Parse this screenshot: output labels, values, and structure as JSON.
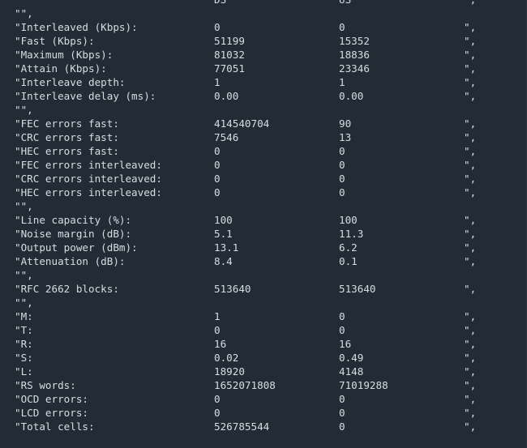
{
  "lines": [
    {
      "label": "",
      "ds": "DS",
      "us": "US",
      "end": "\","
    },
    {
      "label": "\"\",",
      "ds": "",
      "us": "",
      "end": ""
    },
    {
      "label": "\"Interleaved (Kbps):",
      "ds": "0",
      "us": "0",
      "end": "\","
    },
    {
      "label": "\"Fast (Kbps):",
      "ds": "51199",
      "us": "15352",
      "end": "\","
    },
    {
      "label": "\"Maximum (Kbps):",
      "ds": "81032",
      "us": "18836",
      "end": "\","
    },
    {
      "label": "\"Attain (Kbps):",
      "ds": "77051",
      "us": "23346",
      "end": "\","
    },
    {
      "label": "\"Interleave depth:",
      "ds": "1",
      "us": "1",
      "end": "\","
    },
    {
      "label": "\"Interleave delay (ms):",
      "ds": "0.00",
      "us": "0.00",
      "end": "\","
    },
    {
      "label": "\"\",",
      "ds": "",
      "us": "",
      "end": ""
    },
    {
      "label": "\"FEC errors fast:",
      "ds": "414540704",
      "us": "90",
      "end": "\","
    },
    {
      "label": "\"CRC errors fast:",
      "ds": "7546",
      "us": "13",
      "end": "\","
    },
    {
      "label": "\"HEC errors fast:",
      "ds": "0",
      "us": "0",
      "end": "\","
    },
    {
      "label": "\"FEC errors interleaved:",
      "ds": "0",
      "us": "0",
      "end": "\","
    },
    {
      "label": "\"CRC errors interleaved:",
      "ds": "0",
      "us": "0",
      "end": "\","
    },
    {
      "label": "\"HEC errors interleaved:",
      "ds": "0",
      "us": "0",
      "end": "\","
    },
    {
      "label": "\"\",",
      "ds": "",
      "us": "",
      "end": ""
    },
    {
      "label": "\"Line capacity (%):",
      "ds": "100",
      "us": "100",
      "end": "\","
    },
    {
      "label": "\"Noise margin (dB):",
      "ds": "5.1",
      "us": "11.3",
      "end": "\","
    },
    {
      "label": "\"Output power (dBm):",
      "ds": "13.1",
      "us": "6.2",
      "end": "\","
    },
    {
      "label": "\"Attenuation (dB):",
      "ds": "8.4",
      "us": "0.1",
      "end": "\","
    },
    {
      "label": "\"\",",
      "ds": "",
      "us": "",
      "end": ""
    },
    {
      "label": "\"RFC 2662 blocks:",
      "ds": "513640",
      "us": "513640",
      "end": "\","
    },
    {
      "label": "\"\",",
      "ds": "",
      "us": "",
      "end": ""
    },
    {
      "label": "\"M:",
      "ds": "1",
      "us": "0",
      "end": "\","
    },
    {
      "label": "\"T:",
      "ds": "0",
      "us": "0",
      "end": "\","
    },
    {
      "label": "\"R:",
      "ds": "16",
      "us": "16",
      "end": "\","
    },
    {
      "label": "\"S:",
      "ds": "0.02",
      "us": "0.49",
      "end": "\","
    },
    {
      "label": "\"L:",
      "ds": "18920",
      "us": "4148",
      "end": "\","
    },
    {
      "label": "\"RS words:",
      "ds": "1652071808",
      "us": "71019288",
      "end": "\","
    },
    {
      "label": "\"OCD errors:",
      "ds": "0",
      "us": "0",
      "end": "\","
    },
    {
      "label": "\"LCD errors:",
      "ds": "0",
      "us": "0",
      "end": "\","
    },
    {
      "label": "\"Total cells:",
      "ds": "526785544",
      "us": "0",
      "end": "\","
    }
  ],
  "colors": {
    "background": "#232c35",
    "text": "#d7dce2"
  }
}
